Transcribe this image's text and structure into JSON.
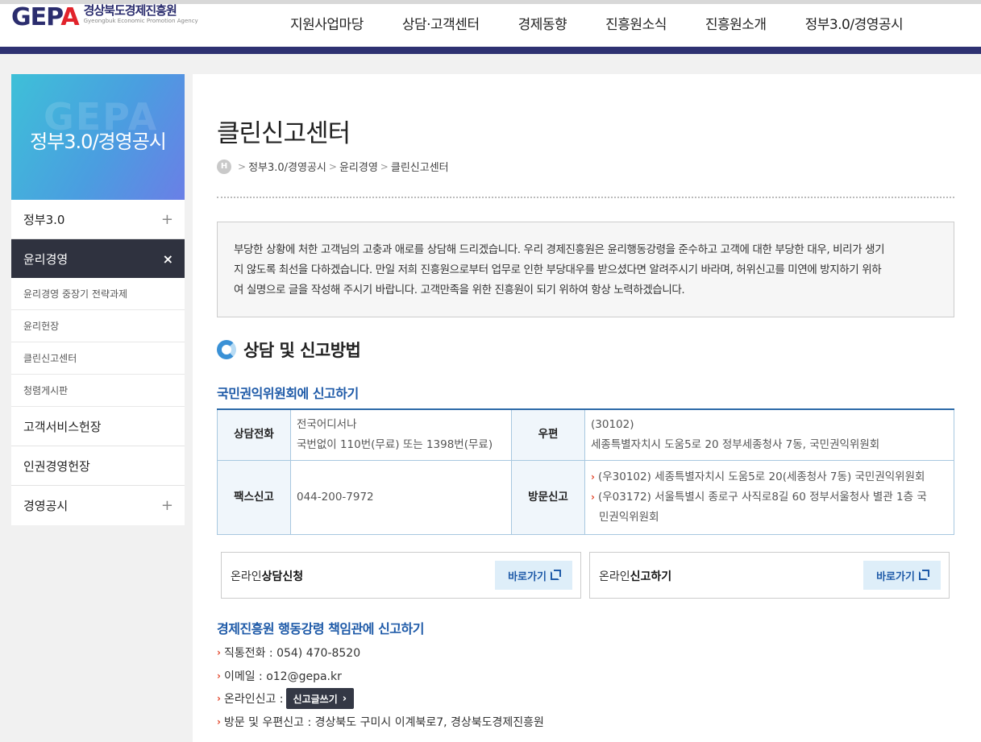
{
  "header": {
    "logo_mark_left": "GEP",
    "logo_mark_right": "A",
    "logo_ko": "경상북도경제진흥원",
    "logo_en": "Gyeongbuk Economic Promotion Agency",
    "nav": [
      "지원사업마당",
      "상담·고객센터",
      "경제동향",
      "진흥원소식",
      "진흥원소개",
      "정부3.0/경영공시"
    ]
  },
  "sidebar": {
    "banner_watermark": "GEPA",
    "banner_title": "정부3.0/경영공시",
    "items": [
      {
        "label": "정부3.0",
        "symbol": "+"
      },
      {
        "label": "윤리경영",
        "symbol": "×"
      }
    ],
    "subitems": [
      "윤리경영 중장기 전략과제",
      "윤리헌장",
      "클린신고센터",
      "청렴게시판"
    ],
    "items_after": [
      {
        "label": "고객서비스헌장",
        "symbol": ""
      },
      {
        "label": "인권경영헌장",
        "symbol": ""
      },
      {
        "label": "경영공시",
        "symbol": "+"
      }
    ]
  },
  "main": {
    "title": "클린신고센터",
    "breadcrumb_home": "H",
    "breadcrumb": [
      "정부3.0/경영공시",
      "윤리경영",
      "클린신고센터"
    ],
    "intro_lines": [
      "부당한 상황에 처한 고객님의 고충과 애로를 상담해 드리겠습니다. 우리 경제진흥원은 윤리행동강령을 준수하고 고객에 대한 부당한 대우, 비리가 생기",
      "지 않도록 최선을 다하겠습니다. 만일 저희 진흥원으로부터 업무로 인한 부당대우를 받으셨다면 알려주시기 바라며, 허위신고를 미연에 방지하기 위하",
      "여 실명으로 글을 작성해 주시기 바랍니다. 고객만족을 위한 진흥원이 되기 위하여 항상 노력하겠습니다."
    ],
    "section_title": "상담 및 신고방법",
    "subsection1": "국민권익위원회에 신고하기",
    "table": {
      "phone_label": "상담전화",
      "phone_line1": "전국어디서나",
      "phone_line2": "국번없이 110번(무료) 또는 1398번(무료)",
      "post_label": "우편",
      "post_line1": "(30102)",
      "post_line2": "세종특별자치시 도움5로 20 정부세종청사 7동, 국민권익위원회",
      "fax_label": "팩스신고",
      "fax_value": "044-200-7972",
      "visit_label": "방문신고",
      "visit_items": [
        "(우30102) 세종특별자치시 도움5로 20(세종청사 7동) 국민권익위원회",
        "(우03172) 서울특별시 종로구 사직로8길 60 정부서울청사 별관 1층 국",
        "민권익위원회"
      ]
    },
    "buttons": [
      {
        "prefix": "온라인",
        "bold": "상담신청",
        "go": "바로가기"
      },
      {
        "prefix": "온라인",
        "bold": "신고하기",
        "go": "바로가기"
      }
    ],
    "subsection2": "경제진흥원 행동강령 책임관에 신고하기",
    "contacts": {
      "phone": "직통전화 : 054) 470-8520",
      "email": "이메일 : o12@gepa.kr",
      "online": "온라인신고 :",
      "write_btn": "신고글쓰기",
      "visit": "방문 및 우편신고 : 경상북도 구미시 이계북로7, 경상북도경제진흥원"
    }
  },
  "colors": {
    "header_bar": "#2e3272",
    "active_menu": "#2f323f",
    "accent_blue": "#1e5aa8",
    "arrow_red": "#e2462b"
  }
}
